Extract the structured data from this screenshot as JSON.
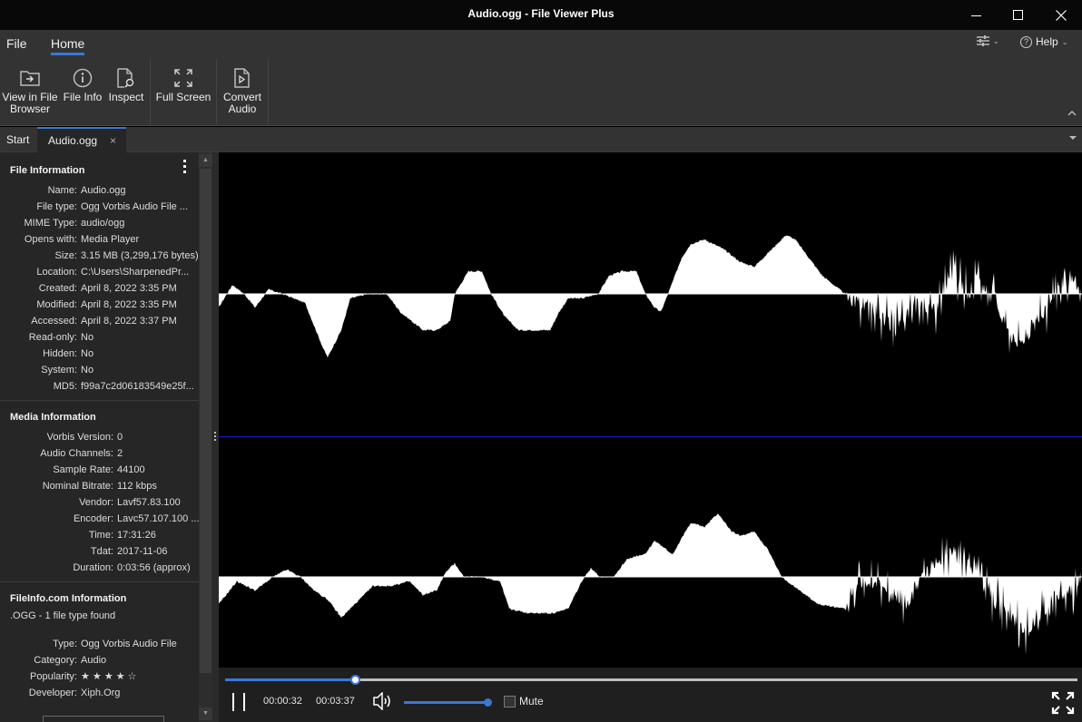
{
  "window": {
    "title": "Audio.ogg - File Viewer Plus",
    "minimize_icon": "minimize-icon",
    "maximize_icon": "maximize-icon",
    "close_icon": "close-icon"
  },
  "menu": {
    "items": [
      {
        "label": "File"
      },
      {
        "label": "Home",
        "active": true
      }
    ],
    "settings_icon": "sliders-icon",
    "help_label": "Help",
    "help_icon": "help-circle-icon"
  },
  "ribbon": {
    "buttons": [
      {
        "label": "View in File Browser",
        "line1": "View in File",
        "line2": "Browser",
        "icon": "folder-arrow-icon"
      },
      {
        "label": "File Info",
        "line1": "File Info",
        "line2": "",
        "icon": "info-circle-icon"
      },
      {
        "label": "Inspect",
        "line1": "Inspect",
        "line2": "",
        "icon": "file-search-icon"
      },
      {
        "label": "Full Screen",
        "line1": "Full Screen",
        "line2": "",
        "icon": "expand-icon"
      },
      {
        "label": "Convert Audio",
        "line1": "Convert",
        "line2": "Audio",
        "icon": "file-play-icon"
      }
    ]
  },
  "tabs": [
    {
      "label": "Start",
      "active": false
    },
    {
      "label": "Audio.ogg",
      "active": true,
      "closable": true,
      "close_glyph": "×"
    }
  ],
  "sidebar": {
    "file_information": {
      "title": "File Information",
      "rows": [
        {
          "key": "Name:",
          "value": "Audio.ogg"
        },
        {
          "key": "File type:",
          "value": "Ogg Vorbis Audio File ..."
        },
        {
          "key": "MIME Type:",
          "value": "audio/ogg"
        },
        {
          "key": "Opens with:",
          "value": "Media Player"
        },
        {
          "key": "Size:",
          "value": "3.15 MB (3,299,176 bytes)"
        },
        {
          "key": "Location:",
          "value": "C:\\Users\\SharpenedPr..."
        },
        {
          "key": "Created:",
          "value": "April 8, 2022 3:35 PM"
        },
        {
          "key": "Modified:",
          "value": "April 8, 2022 3:35 PM"
        },
        {
          "key": "Accessed:",
          "value": "April 8, 2022 3:37 PM"
        },
        {
          "key": "Read-only:",
          "value": "No"
        },
        {
          "key": "Hidden:",
          "value": "No"
        },
        {
          "key": "System:",
          "value": "No"
        },
        {
          "key": "MD5:",
          "value": "f99a7c2d06183549e25f..."
        }
      ]
    },
    "media_information": {
      "title": "Media Information",
      "rows": [
        {
          "key": "Vorbis Version:",
          "value": "0"
        },
        {
          "key": "Audio Channels:",
          "value": "2"
        },
        {
          "key": "Sample Rate:",
          "value": "44100"
        },
        {
          "key": "Nominal Bitrate:",
          "value": "112 kbps"
        },
        {
          "key": "Vendor:",
          "value": "Lavf57.83.100"
        },
        {
          "key": "Encoder:",
          "value": "Lavc57.107.100 ..."
        },
        {
          "key": "Time:",
          "value": "17:31:26"
        },
        {
          "key": "Tdat:",
          "value": "2017-11-06"
        },
        {
          "key": "Duration:",
          "value": "0:03:56 (approx)"
        }
      ]
    },
    "fileinfo_information": {
      "title": "FileInfo.com Information",
      "summary": ".OGG - 1 file type found",
      "rows": [
        {
          "key": "Type:",
          "value": "Ogg Vorbis Audio File"
        },
        {
          "key": "Category:",
          "value": "Audio"
        },
        {
          "key": "Popularity:",
          "value": "★ ★ ★ ★ ☆"
        },
        {
          "key": "Developer:",
          "value": "Xiph.Org"
        }
      ],
      "popularity_stars": 4,
      "popularity_max": 5
    }
  },
  "player": {
    "current_time": "00:00:32",
    "total_time": "00:03:37",
    "progress_fraction": 0.152,
    "volume_fraction": 1.0,
    "mute_label": "Mute",
    "muted": false,
    "state": "playing",
    "pause_icon": "pause-icon",
    "volume_icon": "speaker-icon",
    "fullscreen_icon": "fullscreen-icon"
  },
  "colors": {
    "accent": "#3a78d4",
    "channel_divider": "#1e1ed2",
    "waveform": "#ffffff",
    "background": "#000000"
  }
}
